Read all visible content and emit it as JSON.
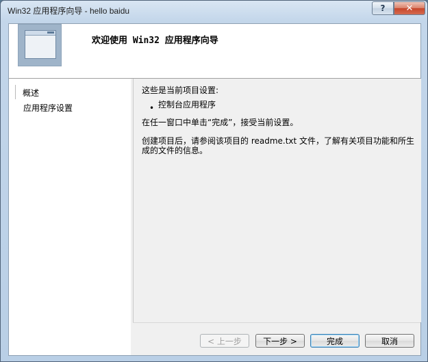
{
  "window": {
    "title": "Win32 应用程序向导 - hello baidu"
  },
  "caption_buttons": {
    "help": "?",
    "close": "✕"
  },
  "header": {
    "title": "欢迎使用 Win32 应用程序向导"
  },
  "nav": {
    "items": [
      {
        "label": "概述"
      },
      {
        "label": "应用程序设置"
      }
    ]
  },
  "content": {
    "intro": "这些是当前项目设置:",
    "bullet_symbol": "•",
    "bullet_item": "控制台应用程序",
    "finish_hint": "在任一窗口中单击“完成”，接受当前设置。",
    "after_create_line1": "创建项目后，请参阅该项目的 readme.txt 文件，了解有关项目功能和所生",
    "after_create_line2": "成的文件的信息。"
  },
  "buttons": {
    "prev": "< 上一步",
    "next": "下一步 >",
    "finish": "完成",
    "cancel": "取消"
  },
  "icons": {
    "wizard_banner": "window-icon"
  }
}
